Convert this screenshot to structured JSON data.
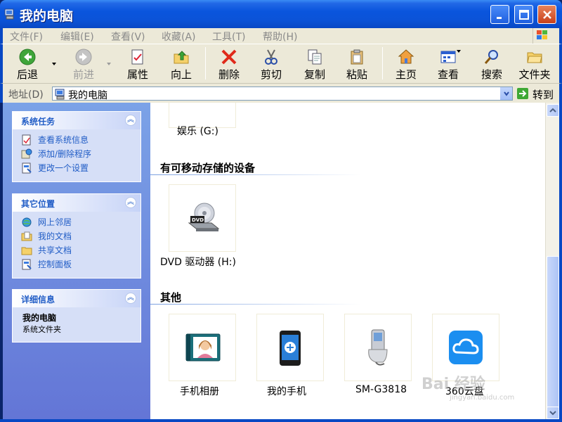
{
  "window": {
    "title": "我的电脑",
    "buttons": {
      "minimize": "minimize",
      "maximize": "maximize",
      "close": "close"
    }
  },
  "menu": {
    "items": [
      "文件(F)",
      "编辑(E)",
      "查看(V)",
      "收藏(A)",
      "工具(T)",
      "帮助(H)"
    ]
  },
  "toolbar": {
    "back": "后退",
    "forward": "前进",
    "properties": "属性",
    "up": "向上",
    "delete": "删除",
    "cut": "剪切",
    "copy": "复制",
    "paste": "粘贴",
    "home": "主页",
    "view": "查看",
    "search": "搜索",
    "folders": "文件夹"
  },
  "address": {
    "label": "地址(D)",
    "value": "我的电脑",
    "go": "转到"
  },
  "sidebar": {
    "system_tasks": {
      "title": "系统任务",
      "items": [
        "查看系统信息",
        "添加/删除程序",
        "更改一个设置"
      ]
    },
    "other_places": {
      "title": "其它位置",
      "items": [
        "网上邻居",
        "我的文档",
        "共享文档",
        "控制面板"
      ]
    },
    "details": {
      "title": "详细信息",
      "name": "我的电脑",
      "type": "系统文件夹"
    }
  },
  "content": {
    "drive_partial": "娱乐 (G:)",
    "removable_header": "有可移动存储的设备",
    "dvd_label": "DVD 驱动器 (H:)",
    "other_header": "其他",
    "others": [
      "手机相册",
      "我的手机",
      "SM-G3818",
      "360云盘"
    ]
  },
  "watermark": {
    "text": "Bai 经验",
    "url": "jingyan.baidu.com"
  },
  "colors": {
    "titlebar": "#0a55dd",
    "sidebar_bg": "#6f8fe0",
    "link": "#215dc6",
    "chrome": "#ece9d8"
  }
}
